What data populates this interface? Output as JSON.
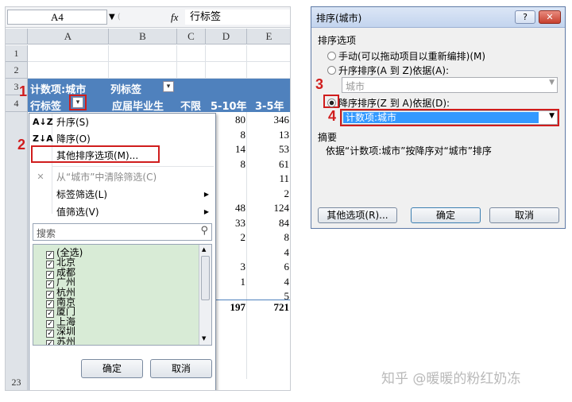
{
  "excel": {
    "name_box": "A4",
    "fx_label": "fx",
    "formula_value": "行标签",
    "columns": [
      "A",
      "B",
      "C",
      "D",
      "E"
    ],
    "rows": [
      "1",
      "2",
      "3",
      "4",
      "23"
    ],
    "pivot_header_row3": {
      "count_label": "计数项:城市",
      "col_labels": "列标签"
    },
    "pivot_header_row4": {
      "row_labels": "行标签",
      "b": "应届毕业生",
      "c": "不限",
      "d": "5-10年",
      "e": "3-5年"
    },
    "values_d": [
      "80",
      "8",
      "14",
      "8",
      "",
      "",
      "48",
      "33",
      "2",
      "",
      "3",
      "1",
      "",
      ""
    ],
    "values_e": [
      "346",
      "13",
      "53",
      "61",
      "11",
      "2",
      "124",
      "84",
      "8",
      "4",
      "6",
      "4",
      "5"
    ],
    "total_d": "197",
    "total_e": "721"
  },
  "filter_menu": {
    "items": [
      {
        "icon": "A↓Z",
        "label": "升序(S)"
      },
      {
        "icon": "Z↓A",
        "label": "降序(O)"
      },
      {
        "icon": "",
        "label": "其他排序选项(M)..."
      },
      {
        "icon": "",
        "label": "从“城市”中清除筛选(C)"
      },
      {
        "icon": "",
        "label": "标签筛选(L)"
      },
      {
        "icon": "",
        "label": "值筛选(V)"
      }
    ],
    "search_placeholder": "搜索",
    "list": [
      "(全选)",
      "北京",
      "成都",
      "广州",
      "杭州",
      "南京",
      "厦门",
      "上海",
      "深圳",
      "苏州"
    ],
    "ok": "确定",
    "cancel": "取消"
  },
  "sort_dialog": {
    "title": "排序(城市)",
    "section_options": "排序选项",
    "opt_manual": "手动(可以拖动项目以重新编排)(M)",
    "opt_asc": "升序排序(A 到 Z)依据(A):",
    "asc_field": "城市",
    "opt_desc": "降序排序(Z 到 A)依据(D):",
    "desc_field": "计数项:城市",
    "section_summary": "摘要",
    "summary_text": "依据“计数项:城市”按降序对“城市”排序",
    "btn_more": "其他选项(R)...",
    "btn_ok": "确定",
    "btn_cancel": "取消"
  },
  "step_labels": [
    "1",
    "2",
    "3",
    "4"
  ],
  "watermark": "知乎 @暖暖的粉红奶冻",
  "colors": {
    "pivot_blue": "#4f81bd",
    "red": "#d01d1d",
    "list_green": "#d8ebd6",
    "select_blue": "#3399ff"
  }
}
